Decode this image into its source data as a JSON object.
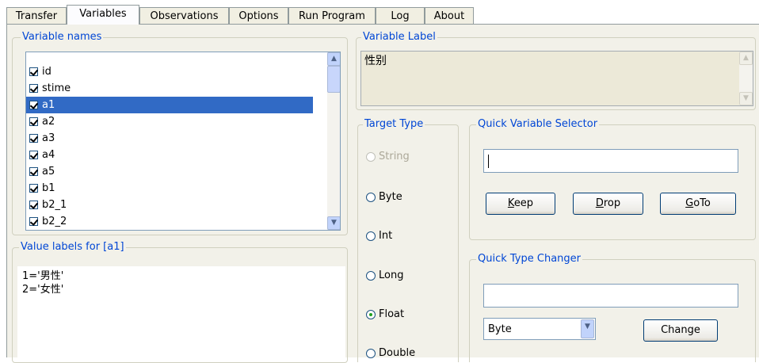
{
  "tabs": [
    {
      "label": "Transfer",
      "active": false
    },
    {
      "label": "Variables",
      "active": true
    },
    {
      "label": "Observations",
      "active": false
    },
    {
      "label": "Options",
      "active": false
    },
    {
      "label": "Run Program",
      "active": false
    },
    {
      "label": "Log",
      "active": false
    },
    {
      "label": "About",
      "active": false
    }
  ],
  "variable_names": {
    "legend": "Variable names",
    "items": [
      {
        "label": "id",
        "checked": true,
        "selected": false
      },
      {
        "label": "stime",
        "checked": true,
        "selected": false
      },
      {
        "label": "a1",
        "checked": true,
        "selected": true
      },
      {
        "label": "a2",
        "checked": true,
        "selected": false
      },
      {
        "label": "a3",
        "checked": true,
        "selected": false
      },
      {
        "label": "a4",
        "checked": true,
        "selected": false
      },
      {
        "label": "a5",
        "checked": true,
        "selected": false
      },
      {
        "label": "b1",
        "checked": true,
        "selected": false
      },
      {
        "label": "b2_1",
        "checked": true,
        "selected": false
      },
      {
        "label": "b2_2",
        "checked": true,
        "selected": false
      }
    ]
  },
  "variable_label": {
    "legend": "Variable Label",
    "value": "性别"
  },
  "value_labels": {
    "legend": "Value labels for  [a1]",
    "lines": [
      "1='男性'",
      "2='女性'"
    ]
  },
  "target_type": {
    "legend": "Target Type",
    "options": [
      {
        "label": "String",
        "enabled": false,
        "selected": false
      },
      {
        "label": "Byte",
        "enabled": true,
        "selected": false
      },
      {
        "label": "Int",
        "enabled": true,
        "selected": false
      },
      {
        "label": "Long",
        "enabled": true,
        "selected": false
      },
      {
        "label": "Float",
        "enabled": true,
        "selected": true
      },
      {
        "label": "Double",
        "enabled": true,
        "selected": false
      }
    ]
  },
  "quick_variable_selector": {
    "legend": "Quick Variable Selector",
    "input_value": "",
    "keep_label": "Keep",
    "drop_label": "Drop",
    "goto_label": "GoTo"
  },
  "quick_type_changer": {
    "legend": "Quick Type Changer",
    "input_value": "",
    "type_value": "Byte",
    "change_label": "Change"
  },
  "colors": {
    "legend_text": "#0046d5",
    "selection": "#316ac5",
    "panel_bg": "#f2f1e9"
  }
}
